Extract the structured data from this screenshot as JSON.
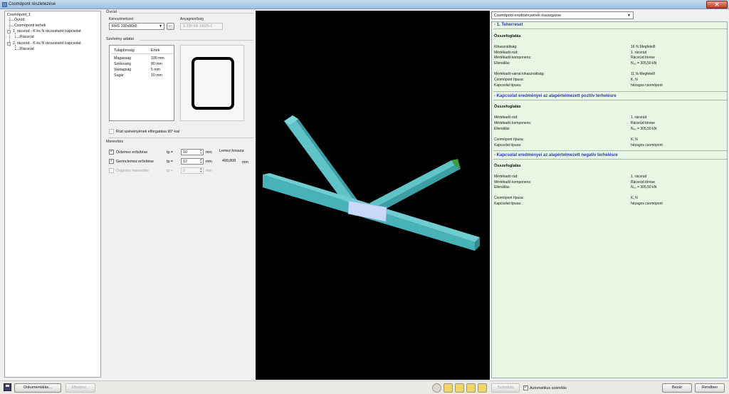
{
  "window": {
    "title": "Csomópont részletezése"
  },
  "tree": {
    "root": "Csomópont_1",
    "items": [
      "Övrúd",
      "Csomóponti terhek",
      "1. rácsrúd - K és N rácsostartó kapcsolat",
      "Rácsrúd",
      "2. rácsrúd - K és N rácsostartó kapcsolat",
      "Rácsrúd"
    ]
  },
  "member": {
    "section_title": "Övrúd",
    "cross_section_label": "Keresztmetszet",
    "cross_section_value": "RHS 100x80x5",
    "browse_label": "...",
    "material_label": "Anyagminőség",
    "material_value": "S 235 EN 10025-2",
    "profile_title": "Szelvény adatai",
    "props_headers": [
      "Tulajdonság",
      "Érték"
    ],
    "props": [
      [
        "Magasság",
        "100 mm"
      ],
      [
        "Szélesség",
        "80 mm"
      ],
      [
        "Vastagság",
        "5 mm"
      ],
      [
        "Sugár",
        "10 mm"
      ]
    ],
    "rotate_label": "Rúd szelvényének elforgatása 90°-kal",
    "stiffening_title": "Merevítés",
    "stiffeners": [
      {
        "label": "Övlemez erősítése",
        "tp": "tp =",
        "value": "10",
        "unit": "mm",
        "checked": true
      },
      {
        "label": "Gerinclemez erősítése",
        "tp": "tp =",
        "value": "12",
        "unit": "mm",
        "checked": true
      },
      {
        "label": "Övgerinc merevítés",
        "tp": "tp =",
        "value": "0",
        "unit": "mm",
        "checked": false
      }
    ],
    "plate_length_label": "Lemez hossza:",
    "plate_length_value": "499,808",
    "plate_length_unit": "mm"
  },
  "results": {
    "selector": "Csomópont eredményeinek összegzése",
    "load_case": "- 1. Teherreset",
    "summary": "Összefoglalás",
    "block1": [
      [
        "Kihasználtság:",
        "16 % Megfelelő"
      ],
      [
        "Mértékadó rúd:",
        "1. rácsrúd"
      ],
      [
        "Mértékadó komponens:",
        "Rácsrúd törése"
      ],
      [
        "Ellenállás:",
        "N₆₀ = 305,50 kN"
      ]
    ],
    "block2": [
      [
        "Mértékadó varrat kihasználtság:",
        "11 % Megfelelő"
      ],
      [
        "Csomópont típusa:",
        "K, N"
      ],
      [
        "Kapcsolat típusa:",
        "hézagos csomópont"
      ]
    ],
    "pos_heading": "- Kapcsolat eredményei az alapértelmezett pozitív terhelésre",
    "pos_block1": [
      [
        "Mértékadó rúd:",
        "1. rácsrúd"
      ],
      [
        "Mértékadó komponens:",
        "Rácsrúd törése"
      ],
      [
        "Ellenállás:",
        "N₆₀ = 305,50 kN"
      ]
    ],
    "pos_block2": [
      [
        "Csomópont típusa:",
        "K, N"
      ],
      [
        "Kapcsolat típusa:",
        "hézagos csomópont"
      ]
    ],
    "neg_heading": "- Kapcsolat eredményei az alapértelmezett negatív terhelésre",
    "neg_block1": [
      [
        "Mértékadó rúd:",
        "1. rácsrúd"
      ],
      [
        "Mértékadó komponens:",
        "Rácsrúd törése"
      ],
      [
        "Ellenállás:",
        "N₆₀ = 305,50 kN"
      ]
    ],
    "neg_block2": [
      [
        "Csomópont típusa:",
        "K, N"
      ],
      [
        "Kapcsolat típusa:",
        "hézagos csomópont"
      ]
    ]
  },
  "bottom": {
    "doc_button": "Dokumentálás...",
    "place_button": "Elhelyez...",
    "calc_button": "Számítás",
    "auto_calc_label": "Automatikus számítás",
    "auto_calc_checked": true,
    "close_button": "Bezár",
    "ok_button": "Rendben"
  },
  "colors": {
    "member": "#5fc3c8",
    "plate": "#c8d8f8",
    "results_bg": "#e7f7e4",
    "heading": "#2a3ab4"
  }
}
